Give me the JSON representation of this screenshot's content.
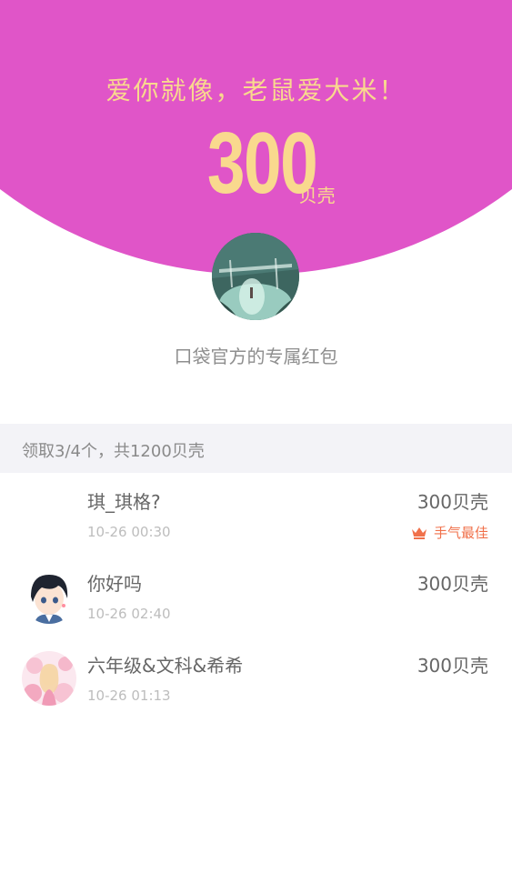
{
  "hero": {
    "slogan": "爱你就像，老鼠爱大米！",
    "amount": "300",
    "unit": "贝壳",
    "bg_color": "#e055c8",
    "text_color": "#f9d98e"
  },
  "sender": {
    "name": "口袋官方的专属红包"
  },
  "summary": {
    "text": "领取3/4个，共1200贝壳"
  },
  "records": [
    {
      "name": "琪_琪格?",
      "time": "10-26 00:30",
      "amount": "300贝壳",
      "badge": "手气最佳",
      "badge_icon": "crown-icon"
    },
    {
      "name": "你好吗",
      "time": "10-26 02:40",
      "amount": "300贝壳"
    },
    {
      "name": "六年级&文科&希希",
      "time": "10-26 01:13",
      "amount": "300贝壳"
    }
  ]
}
